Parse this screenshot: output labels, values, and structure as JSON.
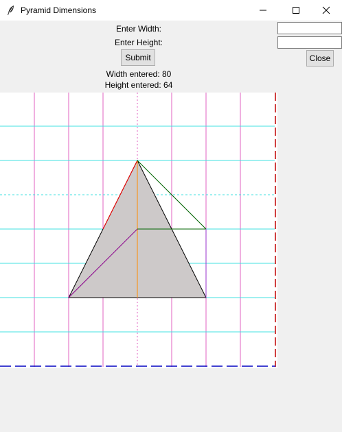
{
  "window": {
    "title": "Pyramid Dimensions",
    "icon": "feather-icon",
    "controls": [
      "minimize-icon",
      "maximize-icon",
      "close-icon"
    ]
  },
  "form": {
    "width_label": "Enter Width:",
    "height_label": "Enter Height:",
    "width_value": "",
    "height_value": "",
    "submit_label": "Submit",
    "close_label": "Close",
    "width_entered": "Width entered: 80",
    "height_entered": "Height entered: 64"
  },
  "colors": {
    "grid_vertical": "#e060c0",
    "grid_horizontal": "#40e0e0",
    "pyramid_fill": "#cdc9c9",
    "border_right": "#c00000",
    "border_bottom": "#0000c0",
    "center_line": "#ff8c00",
    "left_edge": "#ff0000",
    "slant_green": "#006400",
    "diagonal_purple": "#8b008b"
  }
}
